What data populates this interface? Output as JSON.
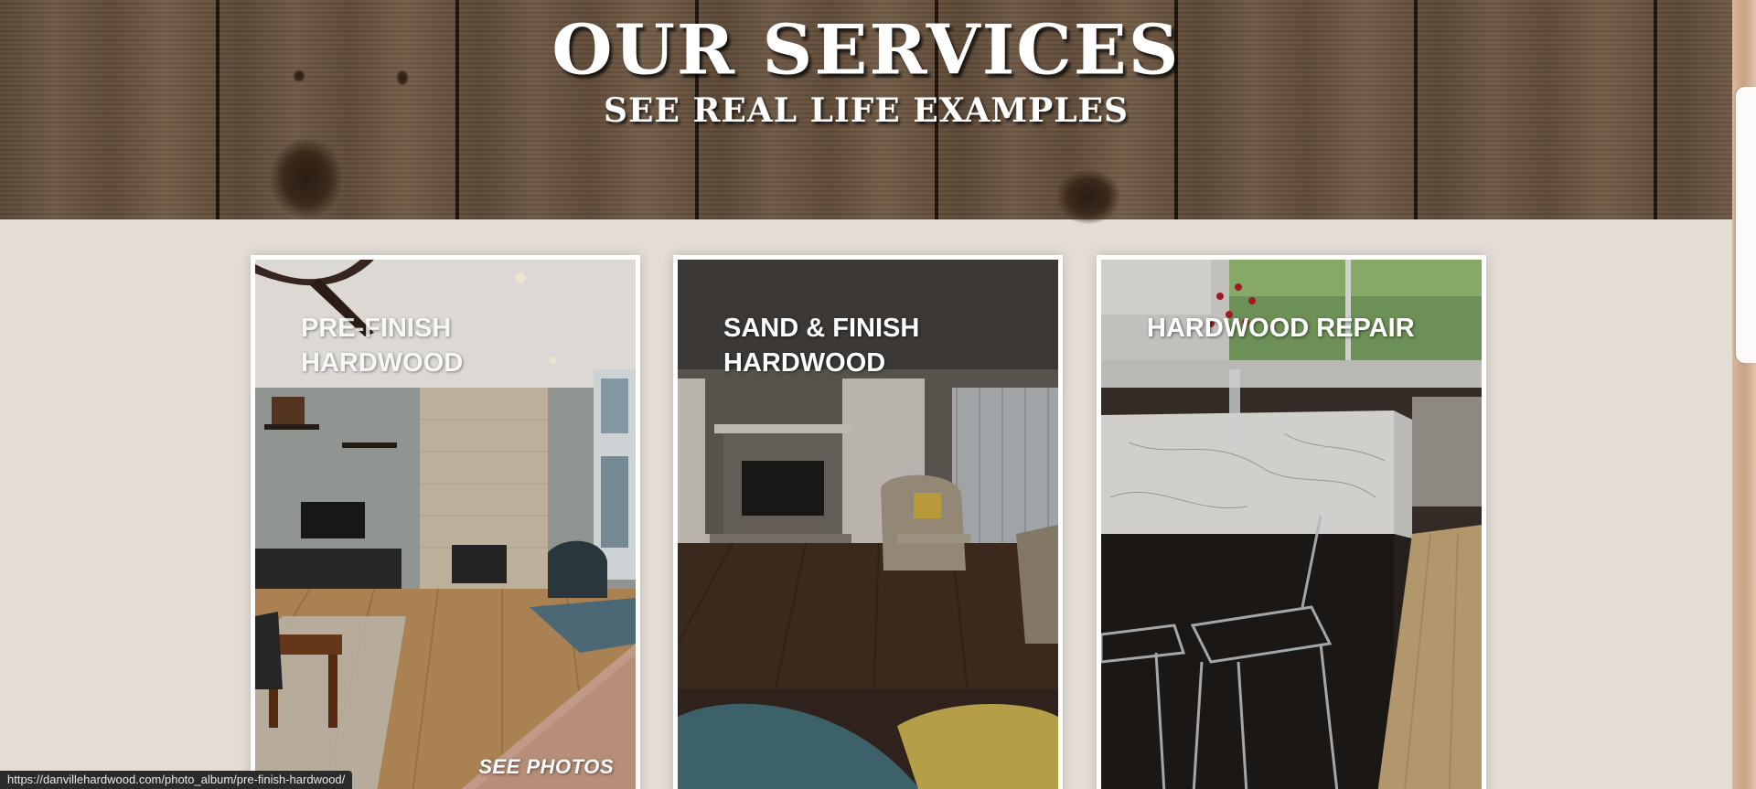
{
  "hero": {
    "title": "OUR SERVICES",
    "subtitle": "SEE REAL LIFE EXAMPLES"
  },
  "cards": [
    {
      "title": "PRE-FINISH HARDWOOD",
      "cta": "SEE PHOTOS",
      "image": "living-room-with-fireplace-photo"
    },
    {
      "title": "SAND & FINISH HARDWOOD",
      "cta": "",
      "image": "living-room-with-stone-fireplace-photo"
    },
    {
      "title": "HARDWOOD REPAIR",
      "cta": "",
      "image": "kitchen-island-photo"
    }
  ],
  "status_bar": {
    "url": "https://danvillehardwood.com/photo_album/pre-finish-hardwood/"
  },
  "colors": {
    "background": "#e4ddd6",
    "card_border": "#ffffff",
    "hero_wood": "#5f4a37"
  }
}
